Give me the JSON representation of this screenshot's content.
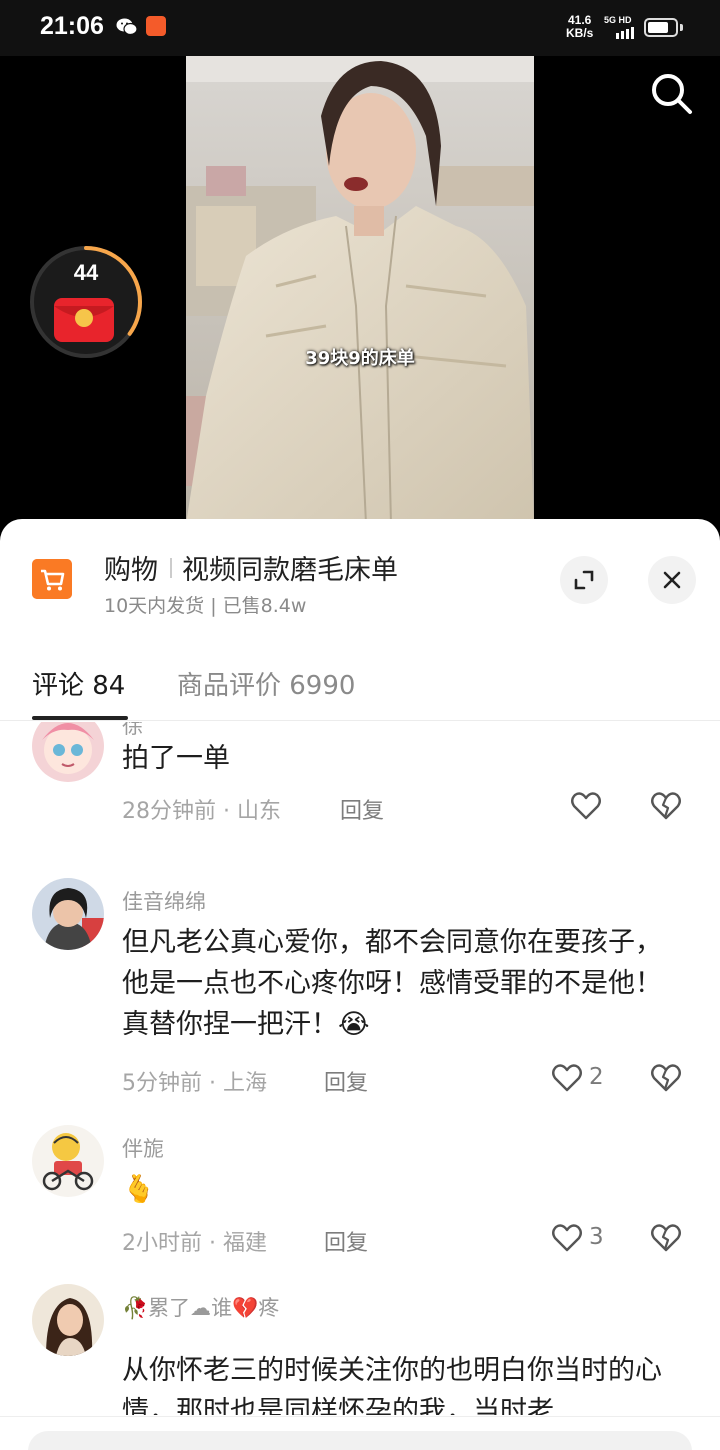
{
  "status_bar": {
    "time": "21:06",
    "speed_value": "41.6",
    "speed_unit": "KB/s",
    "network": "5G HD",
    "battery_level": 0.75,
    "icons": [
      "wechat-icon",
      "app-notification-icon",
      "signal-icon",
      "battery-icon"
    ]
  },
  "video": {
    "caption": "39块9的床单",
    "red_packet_count": "44",
    "red_packet_progress": 0.35
  },
  "product": {
    "category": "购物",
    "title": "视频同款磨毛床单",
    "subtitle": "10天内发货 | 已售8.4w"
  },
  "tabs": [
    {
      "label": "评论 84",
      "active": true
    },
    {
      "label": "商品评价 6990",
      "active": false
    }
  ],
  "comments": [
    {
      "name": "徐",
      "text": "拍了一单",
      "time_location": "28分钟前 · 山东",
      "reply": "回复",
      "likes": ""
    },
    {
      "name": "佳音绵绵",
      "text": "但凡老公真心爱你，都不会同意你在要孩子，他是一点也不心疼你呀！感情受罪的不是他！真替你捏一把汗！😭",
      "time_location": "5分钟前 · 上海",
      "reply": "回复",
      "likes": "2"
    },
    {
      "name": "伴旎",
      "text": "🫰",
      "time_location": "2小时前 · 福建",
      "reply": "回复",
      "likes": "3"
    },
    {
      "name": "🥀累了☁谁💔疼",
      "text": "从你怀老三的时候关注你的也明白你当时的心情，那时也是同样怀孕的我，当时老",
      "time_location": "",
      "reply": "",
      "likes": ""
    }
  ],
  "colors": {
    "cart_orange": "#fa7a24",
    "red_packet": "#e8242c",
    "ring_orange": "#f7a64b"
  }
}
